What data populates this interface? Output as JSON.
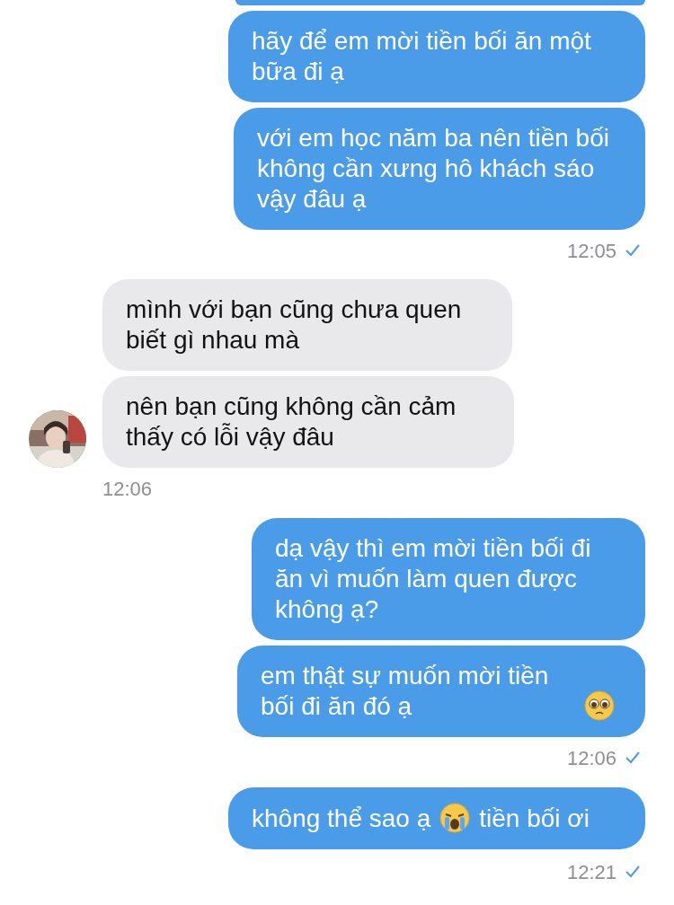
{
  "messages": [
    {
      "kind": "cut-bubble"
    },
    {
      "kind": "sent",
      "segments": [
        {
          "kind": "text",
          "text": "hãy để em mời tiền bối ăn một bữa đi ạ"
        }
      ]
    },
    {
      "kind": "sent",
      "segments": [
        {
          "kind": "text",
          "text": "với em học năm ba nên tiền bối không cần xưng hô khách sáo vậy đâu ạ"
        }
      ]
    },
    {
      "kind": "sent-time",
      "text": "12:05",
      "read": true
    },
    {
      "kind": "received",
      "segments": [
        {
          "kind": "text",
          "text": "mình với bạn cũng chưa quen biết gì nhau mà"
        }
      ]
    },
    {
      "kind": "received",
      "segments": [
        {
          "kind": "text",
          "text": "nên bạn cũng không cần cảm thấy có lỗi vậy đâu"
        }
      ]
    },
    {
      "kind": "received-time",
      "text": "12:06"
    },
    {
      "kind": "sent",
      "segments": [
        {
          "kind": "text",
          "text": "dạ vậy thì em mời tiền bối đi ăn vì muốn làm quen được không ạ?"
        }
      ]
    },
    {
      "kind": "sent",
      "segments": [
        {
          "kind": "text",
          "text": "em thật sự muốn mời tiền bối đi ăn đó ạ"
        },
        {
          "kind": "pleading-face"
        }
      ]
    },
    {
      "kind": "sent-time",
      "text": "12:06",
      "read": true
    },
    {
      "kind": "sent",
      "segments": [
        {
          "kind": "text",
          "text": "không thể sao ạ"
        },
        {
          "kind": "crying-face"
        },
        {
          "kind": "text",
          "text": "tiền bối ơi"
        }
      ]
    },
    {
      "kind": "sent-time",
      "text": "12:21",
      "read": true
    }
  ]
}
